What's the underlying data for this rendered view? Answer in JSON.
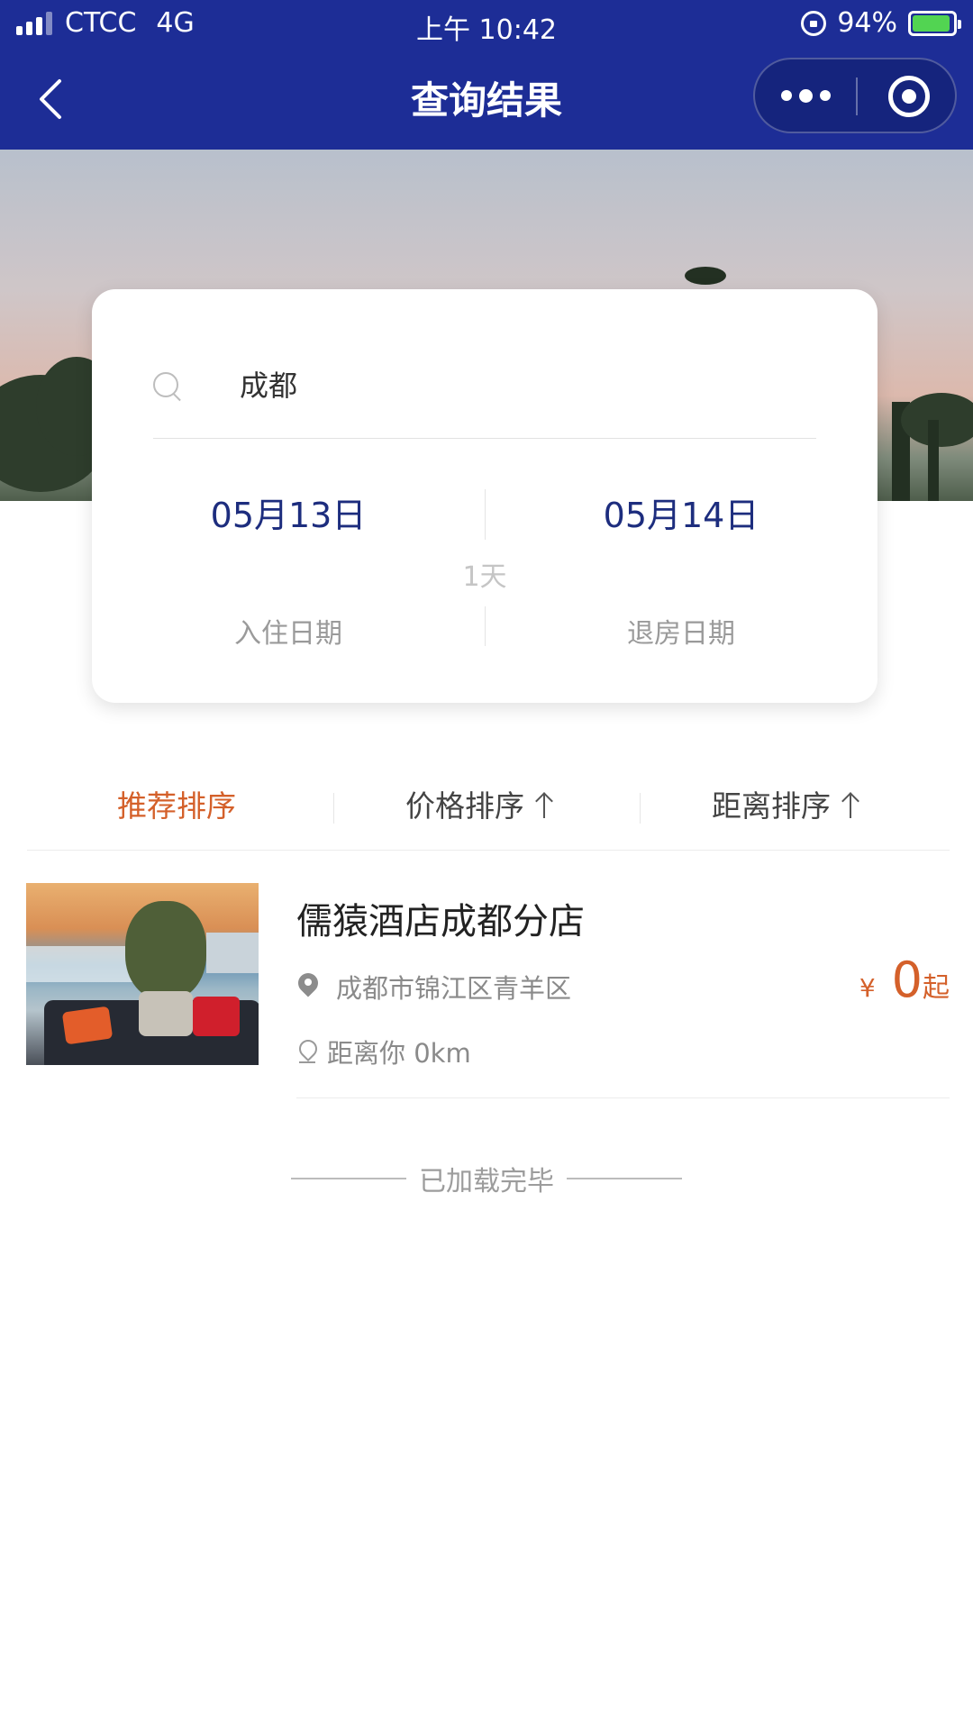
{
  "status_bar": {
    "carrier": "CTCC",
    "network": "4G",
    "time": "上午 10:42",
    "battery": "94%"
  },
  "nav": {
    "title": "查询结果"
  },
  "search": {
    "keyword": "成都",
    "checkin_date": "05月13日",
    "checkout_date": "05月14日",
    "nights": "1天",
    "checkin_label": "入住日期",
    "checkout_label": "退房日期"
  },
  "sort": {
    "recommended": "推荐排序",
    "price": "价格排序",
    "distance": "距离排序"
  },
  "hotels": [
    {
      "name": "儒猿酒店成都分店",
      "address": "成都市锦江区青羊区",
      "distance": "距离你 0km",
      "currency": "¥",
      "price": "0",
      "price_suffix": "起"
    }
  ],
  "footer": {
    "end_text": "已加载完毕"
  },
  "colors": {
    "nav_bg": "#1d2d96",
    "accent": "#d4602a",
    "date_text": "#1d2d7e"
  }
}
